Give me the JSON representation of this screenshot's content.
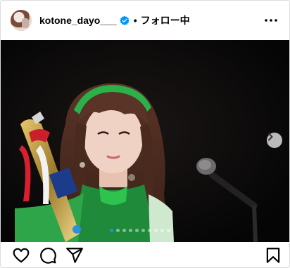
{
  "post": {
    "username": "kotone_dayo___",
    "separator": "•",
    "follow_label": "フォロー中",
    "verified": true,
    "carousel": {
      "slide_count": 10,
      "active_index": 0
    }
  },
  "icons": {
    "avatar": "profile-avatar",
    "verified": "verified-badge-icon",
    "more": "more-options-icon",
    "next": "carousel-next-icon",
    "like": "heart-icon",
    "comment": "comment-icon",
    "share": "share-icon",
    "save": "bookmark-icon"
  },
  "colors": {
    "verified_blue": "#0095f6",
    "active_dot": "#1a93f0",
    "border": "#dbdbdb"
  }
}
